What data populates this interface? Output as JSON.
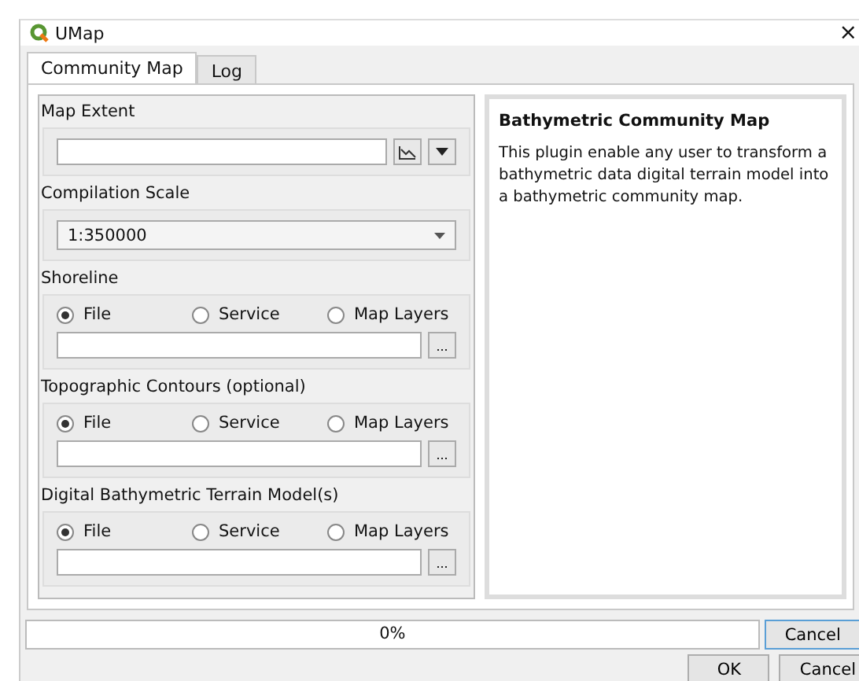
{
  "window": {
    "title": "UMap",
    "close": "×"
  },
  "tabs": [
    {
      "label": "Community Map",
      "selected": true
    },
    {
      "label": "Log",
      "selected": false
    }
  ],
  "map_extent": {
    "label": "Map Extent"
  },
  "compilation_scale": {
    "label": "Compilation Scale",
    "value": "1:350000"
  },
  "sources": [
    {
      "label": "Shoreline",
      "options": [
        {
          "label": "File",
          "selected": true
        },
        {
          "label": "Service",
          "selected": false
        },
        {
          "label": "Map Layers",
          "selected": false
        }
      ],
      "browse": "..."
    },
    {
      "label": "Topographic Contours (optional)",
      "options": [
        {
          "label": "File",
          "selected": true
        },
        {
          "label": "Service",
          "selected": false
        },
        {
          "label": "Map Layers",
          "selected": false
        }
      ],
      "browse": "..."
    },
    {
      "label": "Digital Bathymetric Terrain Model(s)",
      "options": [
        {
          "label": "File",
          "selected": true
        },
        {
          "label": "Service",
          "selected": false
        },
        {
          "label": "Map Layers",
          "selected": false
        }
      ],
      "browse": "..."
    }
  ],
  "help": {
    "title": "Bathymetric Community Map",
    "text": "This plugin enable any user to transform a bathymetric data digital terrain model into a bathymetric community map."
  },
  "progress": {
    "text": "0%",
    "cancel": "Cancel"
  },
  "buttons": [
    "OK",
    "Cancel"
  ]
}
